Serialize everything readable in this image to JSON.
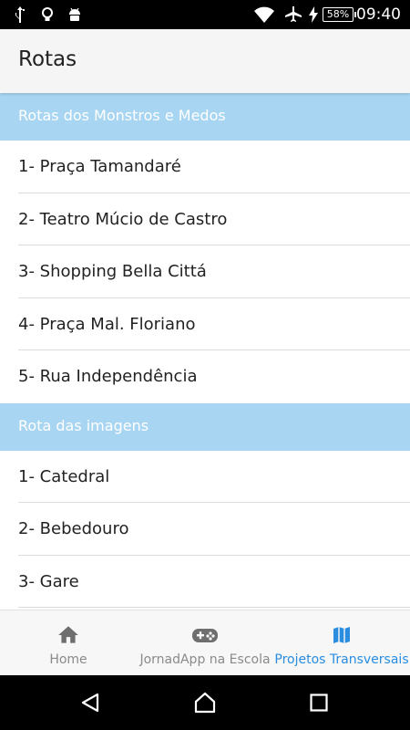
{
  "status_bar": {
    "time": "09:40",
    "battery": "58%",
    "icons": [
      "usb-icon",
      "lightbulb-icon",
      "android-icon",
      "wifi-icon",
      "airplane-icon",
      "charging-icon"
    ]
  },
  "app_bar": {
    "title": "Rotas"
  },
  "sections": [
    {
      "header": "Rotas dos Monstros e Medos",
      "items": [
        "1- Praça Tamandaré",
        "2- Teatro Múcio de Castro",
        "3- Shopping Bella Cittá",
        "4- Praça Mal. Floriano",
        "5- Rua Independência"
      ]
    },
    {
      "header": "Rota das imagens",
      "items": [
        "1- Catedral",
        "2- Bebedouro",
        "3- Gare"
      ]
    }
  ],
  "bottom_nav": {
    "tabs": [
      {
        "label": "Home",
        "icon": "home-icon"
      },
      {
        "label": "JornadApp na Escola",
        "icon": "gamepad-icon"
      },
      {
        "label": "Projetos Transversais",
        "icon": "map-icon",
        "active": true
      }
    ]
  },
  "colors": {
    "section_header": "#a8d5f2",
    "accent": "#2a8de0"
  }
}
